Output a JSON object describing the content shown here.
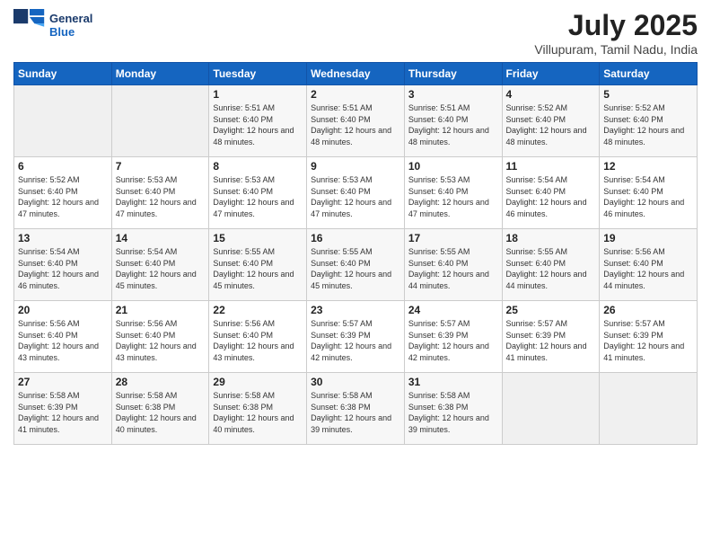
{
  "logo": {
    "line1": "General",
    "line2": "Blue"
  },
  "title": "July 2025",
  "subtitle": "Villupuram, Tamil Nadu, India",
  "headers": [
    "Sunday",
    "Monday",
    "Tuesday",
    "Wednesday",
    "Thursday",
    "Friday",
    "Saturday"
  ],
  "weeks": [
    [
      {
        "day": "",
        "sunrise": "",
        "sunset": "",
        "daylight": ""
      },
      {
        "day": "",
        "sunrise": "",
        "sunset": "",
        "daylight": ""
      },
      {
        "day": "1",
        "sunrise": "Sunrise: 5:51 AM",
        "sunset": "Sunset: 6:40 PM",
        "daylight": "Daylight: 12 hours and 48 minutes."
      },
      {
        "day": "2",
        "sunrise": "Sunrise: 5:51 AM",
        "sunset": "Sunset: 6:40 PM",
        "daylight": "Daylight: 12 hours and 48 minutes."
      },
      {
        "day": "3",
        "sunrise": "Sunrise: 5:51 AM",
        "sunset": "Sunset: 6:40 PM",
        "daylight": "Daylight: 12 hours and 48 minutes."
      },
      {
        "day": "4",
        "sunrise": "Sunrise: 5:52 AM",
        "sunset": "Sunset: 6:40 PM",
        "daylight": "Daylight: 12 hours and 48 minutes."
      },
      {
        "day": "5",
        "sunrise": "Sunrise: 5:52 AM",
        "sunset": "Sunset: 6:40 PM",
        "daylight": "Daylight: 12 hours and 48 minutes."
      }
    ],
    [
      {
        "day": "6",
        "sunrise": "Sunrise: 5:52 AM",
        "sunset": "Sunset: 6:40 PM",
        "daylight": "Daylight: 12 hours and 47 minutes."
      },
      {
        "day": "7",
        "sunrise": "Sunrise: 5:53 AM",
        "sunset": "Sunset: 6:40 PM",
        "daylight": "Daylight: 12 hours and 47 minutes."
      },
      {
        "day": "8",
        "sunrise": "Sunrise: 5:53 AM",
        "sunset": "Sunset: 6:40 PM",
        "daylight": "Daylight: 12 hours and 47 minutes."
      },
      {
        "day": "9",
        "sunrise": "Sunrise: 5:53 AM",
        "sunset": "Sunset: 6:40 PM",
        "daylight": "Daylight: 12 hours and 47 minutes."
      },
      {
        "day": "10",
        "sunrise": "Sunrise: 5:53 AM",
        "sunset": "Sunset: 6:40 PM",
        "daylight": "Daylight: 12 hours and 47 minutes."
      },
      {
        "day": "11",
        "sunrise": "Sunrise: 5:54 AM",
        "sunset": "Sunset: 6:40 PM",
        "daylight": "Daylight: 12 hours and 46 minutes."
      },
      {
        "day": "12",
        "sunrise": "Sunrise: 5:54 AM",
        "sunset": "Sunset: 6:40 PM",
        "daylight": "Daylight: 12 hours and 46 minutes."
      }
    ],
    [
      {
        "day": "13",
        "sunrise": "Sunrise: 5:54 AM",
        "sunset": "Sunset: 6:40 PM",
        "daylight": "Daylight: 12 hours and 46 minutes."
      },
      {
        "day": "14",
        "sunrise": "Sunrise: 5:54 AM",
        "sunset": "Sunset: 6:40 PM",
        "daylight": "Daylight: 12 hours and 45 minutes."
      },
      {
        "day": "15",
        "sunrise": "Sunrise: 5:55 AM",
        "sunset": "Sunset: 6:40 PM",
        "daylight": "Daylight: 12 hours and 45 minutes."
      },
      {
        "day": "16",
        "sunrise": "Sunrise: 5:55 AM",
        "sunset": "Sunset: 6:40 PM",
        "daylight": "Daylight: 12 hours and 45 minutes."
      },
      {
        "day": "17",
        "sunrise": "Sunrise: 5:55 AM",
        "sunset": "Sunset: 6:40 PM",
        "daylight": "Daylight: 12 hours and 44 minutes."
      },
      {
        "day": "18",
        "sunrise": "Sunrise: 5:55 AM",
        "sunset": "Sunset: 6:40 PM",
        "daylight": "Daylight: 12 hours and 44 minutes."
      },
      {
        "day": "19",
        "sunrise": "Sunrise: 5:56 AM",
        "sunset": "Sunset: 6:40 PM",
        "daylight": "Daylight: 12 hours and 44 minutes."
      }
    ],
    [
      {
        "day": "20",
        "sunrise": "Sunrise: 5:56 AM",
        "sunset": "Sunset: 6:40 PM",
        "daylight": "Daylight: 12 hours and 43 minutes."
      },
      {
        "day": "21",
        "sunrise": "Sunrise: 5:56 AM",
        "sunset": "Sunset: 6:40 PM",
        "daylight": "Daylight: 12 hours and 43 minutes."
      },
      {
        "day": "22",
        "sunrise": "Sunrise: 5:56 AM",
        "sunset": "Sunset: 6:40 PM",
        "daylight": "Daylight: 12 hours and 43 minutes."
      },
      {
        "day": "23",
        "sunrise": "Sunrise: 5:57 AM",
        "sunset": "Sunset: 6:39 PM",
        "daylight": "Daylight: 12 hours and 42 minutes."
      },
      {
        "day": "24",
        "sunrise": "Sunrise: 5:57 AM",
        "sunset": "Sunset: 6:39 PM",
        "daylight": "Daylight: 12 hours and 42 minutes."
      },
      {
        "day": "25",
        "sunrise": "Sunrise: 5:57 AM",
        "sunset": "Sunset: 6:39 PM",
        "daylight": "Daylight: 12 hours and 41 minutes."
      },
      {
        "day": "26",
        "sunrise": "Sunrise: 5:57 AM",
        "sunset": "Sunset: 6:39 PM",
        "daylight": "Daylight: 12 hours and 41 minutes."
      }
    ],
    [
      {
        "day": "27",
        "sunrise": "Sunrise: 5:58 AM",
        "sunset": "Sunset: 6:39 PM",
        "daylight": "Daylight: 12 hours and 41 minutes."
      },
      {
        "day": "28",
        "sunrise": "Sunrise: 5:58 AM",
        "sunset": "Sunset: 6:38 PM",
        "daylight": "Daylight: 12 hours and 40 minutes."
      },
      {
        "day": "29",
        "sunrise": "Sunrise: 5:58 AM",
        "sunset": "Sunset: 6:38 PM",
        "daylight": "Daylight: 12 hours and 40 minutes."
      },
      {
        "day": "30",
        "sunrise": "Sunrise: 5:58 AM",
        "sunset": "Sunset: 6:38 PM",
        "daylight": "Daylight: 12 hours and 39 minutes."
      },
      {
        "day": "31",
        "sunrise": "Sunrise: 5:58 AM",
        "sunset": "Sunset: 6:38 PM",
        "daylight": "Daylight: 12 hours and 39 minutes."
      },
      {
        "day": "",
        "sunrise": "",
        "sunset": "",
        "daylight": ""
      },
      {
        "day": "",
        "sunrise": "",
        "sunset": "",
        "daylight": ""
      }
    ]
  ]
}
